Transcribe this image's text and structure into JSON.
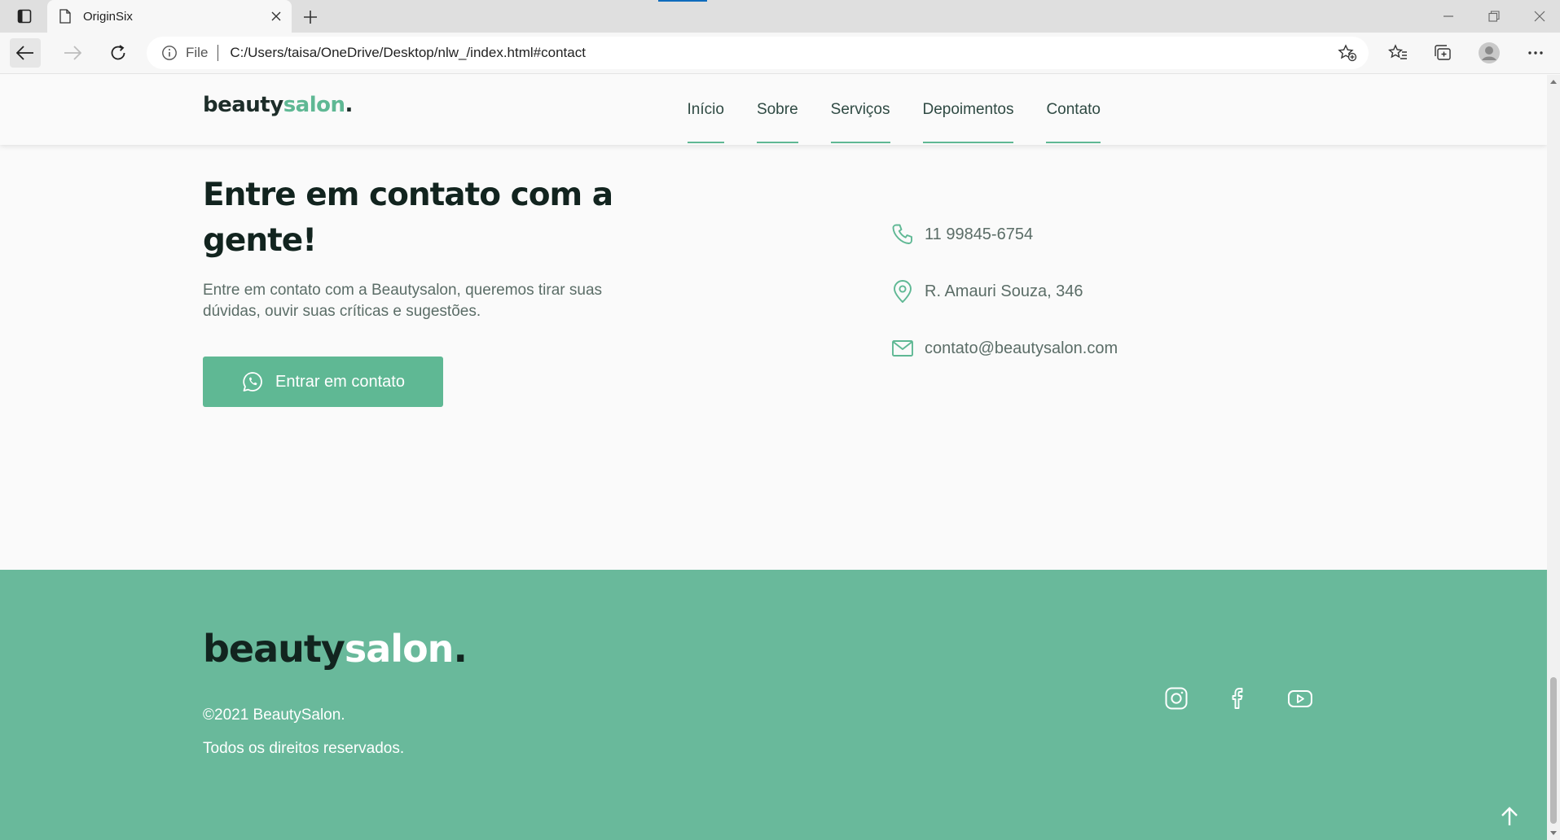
{
  "browser": {
    "tab_title": "OriginSix",
    "address_scheme": "File",
    "url": "C:/Users/taisa/OneDrive/Desktop/nlw_/index.html#contact"
  },
  "site": {
    "logo": {
      "part_a": "beauty",
      "part_b": "salon",
      "dot": "."
    },
    "menu": [
      {
        "label": "Início"
      },
      {
        "label": "Sobre"
      },
      {
        "label": "Serviços"
      },
      {
        "label": "Depoimentos"
      },
      {
        "label": "Contato"
      }
    ],
    "accent_color": "#5fb894"
  },
  "contact": {
    "title": "Entre em contato com a gente!",
    "description": "Entre em contato com a Beautysalon, queremos tirar suas dúvidas, ouvir suas críticas e sugestões.",
    "button_label": "Entrar em contato",
    "items": [
      {
        "icon": "phone-icon",
        "text": "11 99845-6754"
      },
      {
        "icon": "map-pin-icon",
        "text": "R. Amauri Souza, 346"
      },
      {
        "icon": "mail-icon",
        "text": "contato@beautysalon.com"
      }
    ]
  },
  "footer": {
    "logo": {
      "part_a": "beauty",
      "part_b": "salon",
      "dot": "."
    },
    "copyright": "©2021 BeautySalon.",
    "rights": "Todos os direitos reservados.",
    "socials": [
      "instagram-icon",
      "facebook-icon",
      "youtube-icon"
    ],
    "background_color": "#69b99b"
  }
}
